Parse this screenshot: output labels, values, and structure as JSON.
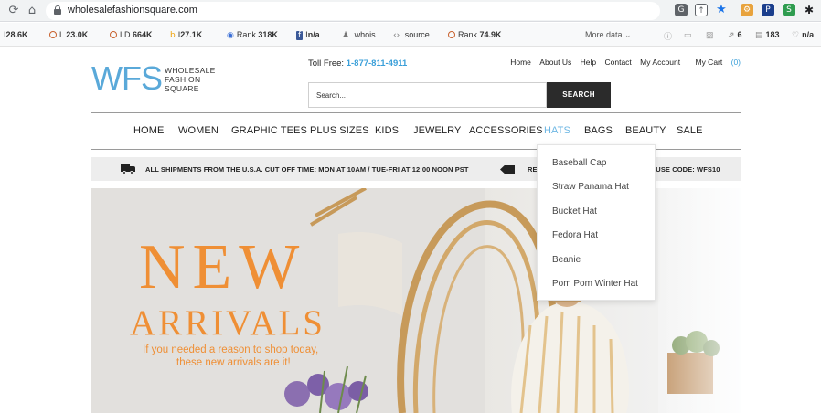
{
  "browser": {
    "url": "wholesalefashionsquare.com"
  },
  "seo_toolbar": {
    "items": [
      {
        "prefix": "I",
        "value": "28.6K"
      },
      {
        "prefix": "L",
        "value": "23.0K"
      },
      {
        "prefix": "LD",
        "value": "664K"
      },
      {
        "prefix": "I",
        "value": "27.1K"
      },
      {
        "prefix": "Rank",
        "value": "318K"
      },
      {
        "prefix": "I",
        "value": "n/a"
      },
      {
        "prefix": "",
        "value": "whois"
      },
      {
        "prefix": "",
        "value": "source"
      },
      {
        "prefix": "Rank",
        "value": "74.9K"
      }
    ],
    "more_data": "More data",
    "right_items": [
      "6",
      "183",
      "n/a"
    ]
  },
  "header": {
    "logo_mark": "WFS",
    "logo_words": [
      "WHOLESALE",
      "FASHION",
      "SQUARE"
    ],
    "toll_label": "Toll Free:",
    "toll_number": "1-877-811-4911",
    "top_links": {
      "home": "Home",
      "about": "About Us",
      "help": "Help",
      "contact": "Contact",
      "account": "My Account",
      "cart": "My Cart",
      "cart_count": "(0)"
    },
    "search_placeholder": "Search...",
    "search_button": "SEARCH"
  },
  "nav": {
    "items": [
      "HOME",
      "WOMEN",
      "GRAPHIC TEES",
      "PLUS SIZES",
      "KIDS",
      "JEWELRY",
      "ACCESSORIES",
      "HATS",
      "BAGS",
      "BEAUTY",
      "SALE"
    ],
    "active": "HATS"
  },
  "shipping": {
    "left_text": "ALL SHIPMENTS FROM THE U.S.A. CUT OFF TIME: MON AT 10AM / TUE-FRI AT 12:00 NOON PST",
    "right_text_start": "RECEIVE 10% OFF ENTIRE WEBSITE. USE CODE: WFS10"
  },
  "hero": {
    "title": "NEW",
    "subtitle": "ARRIVALS",
    "line1": "If you needed a reason to shop today,",
    "line2": "these new arrivals are it!"
  },
  "dropdown": {
    "items": [
      "Baseball Cap",
      "Straw Panama Hat",
      "Bucket Hat",
      "Fedora Hat",
      "Beanie",
      "Pom Pom Winter Hat"
    ]
  },
  "colors": {
    "brand_blue": "#5aa9d9",
    "hero_orange": "#ef8f35",
    "active_nav": "#6cb6e3"
  }
}
